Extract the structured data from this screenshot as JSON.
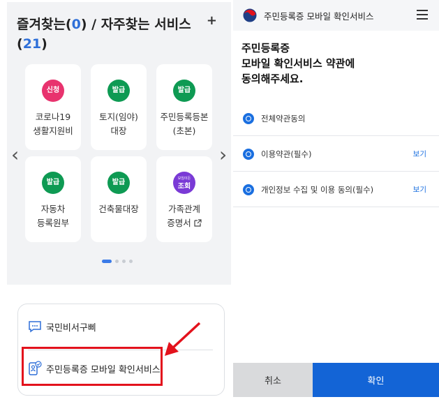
{
  "favorites": {
    "title_prefix": "즐겨찾는(",
    "fav_count": "0",
    "title_middle": ") / 자주찾는 서비스 (",
    "freq_count": "21",
    "title_suffix": ")",
    "plus": "+",
    "cards": [
      {
        "badge": "신청",
        "label1": "코로나19",
        "label2": "생활지원비",
        "badge_color": "#e8336e"
      },
      {
        "badge": "발급",
        "label1": "토지(임야)",
        "label2": "대장",
        "badge_color": "#0e9a53"
      },
      {
        "badge": "발급",
        "label1": "주민등록등본",
        "label2": "(초본)",
        "badge_color": "#0e9a53"
      },
      {
        "badge": "발급",
        "label1": "자동차",
        "label2": "등록원부",
        "badge_color": "#0e9a53"
      },
      {
        "badge": "발급",
        "label1": "건축물대장",
        "label2": "",
        "badge_color": "#0e9a53"
      },
      {
        "badge_small": "모임이든",
        "badge": "조회",
        "label1": "가족관계",
        "label2": "증명서",
        "badge_color": "#7a3ad6"
      }
    ],
    "prev_arrow": "‹",
    "next_arrow": "›"
  },
  "menu": {
    "item1": "국민비서구삐",
    "item2": "주민등록증 모바일 확인서비스"
  },
  "mobile": {
    "title": "주민등록증 모바일 확인서비스",
    "heading1": "주민등록증",
    "heading2": "모바일 확인서비스 약관에",
    "heading3": "동의해주세요.",
    "terms": [
      {
        "label": "전체약관동의",
        "view": ""
      },
      {
        "label": "이용약관(필수)",
        "view": "보기"
      },
      {
        "label": "개인정보 수집 및 이용 동의(필수)",
        "view": "보기"
      }
    ],
    "cancel": "취소",
    "confirm": "확인"
  },
  "colors": {
    "accent": "#1364d6",
    "highlight": "#e3121c",
    "green_badge": "#0e9a53"
  }
}
